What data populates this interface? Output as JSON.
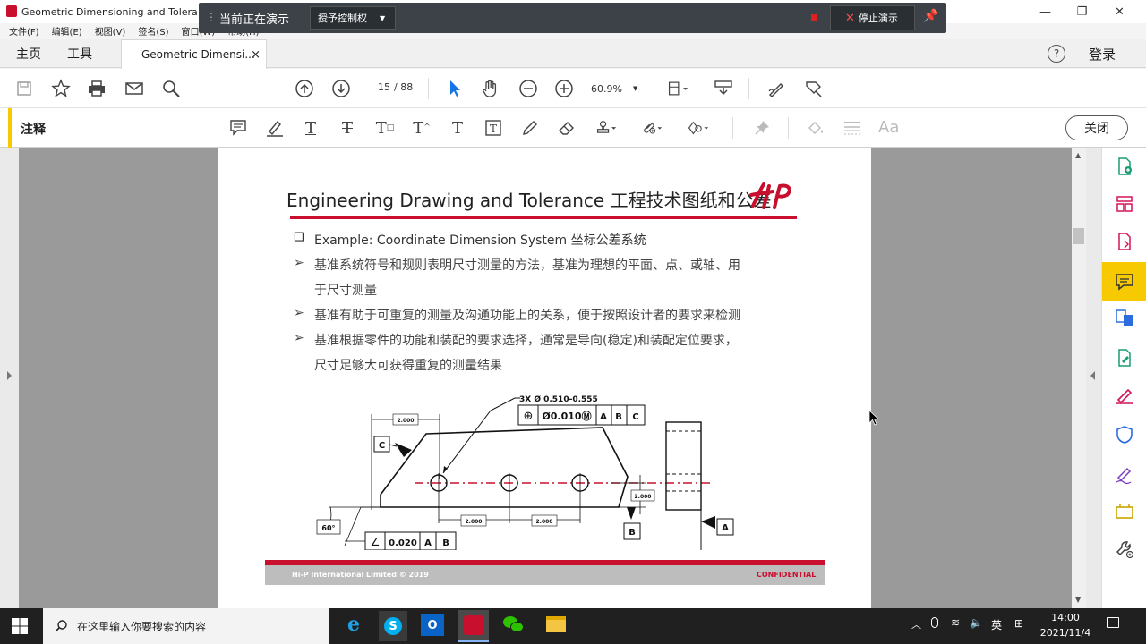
{
  "window": {
    "title": "Geometric Dimensioning and Tolera",
    "minimize": "—",
    "restore": "❐",
    "close": "✕"
  },
  "presentation": {
    "status": "当前正在演示",
    "control": "授予控制权",
    "stop": "停止演示"
  },
  "menu": [
    "文件(F)",
    "编辑(E)",
    "视图(V)",
    "签名(S)",
    "窗口(W)",
    "帮助(H)"
  ],
  "tabs": {
    "home": "主页",
    "tools": "工具",
    "doc": "Geometric Dimensi...",
    "close": "×",
    "help": "?",
    "login": "登录"
  },
  "nav": {
    "page": "15",
    "total": "/ 88",
    "zoom": "60.9%"
  },
  "annot": {
    "label": "注释",
    "close": "关闭",
    "font": "Aa"
  },
  "slide": {
    "title": "Engineering Drawing and Tolerance 工程技术图纸和公差",
    "bullets": [
      {
        "marker": "❑",
        "text": "Example: Coordinate Dimension System 坐标公差系统"
      },
      {
        "marker": "➢",
        "text": "基准系统符号和规则表明尺寸测量的方法，基准为理想的平面、点、或轴、用"
      },
      {
        "marker": "",
        "text": "于尺寸测量"
      },
      {
        "marker": "➢",
        "text": "基准有助于可重复的测量及沟通功能上的关系，便于按照设计者的要求来检测"
      },
      {
        "marker": "➢",
        "text": "基准根据零件的功能和装配的要求选择，通常是导向(稳定)和装配定位要求，"
      },
      {
        "marker": "",
        "text": "尺寸足够大可获得重复的测量结果"
      }
    ],
    "drawing": {
      "holes": "3X Ø 0.510-0.555",
      "fcf": [
        "⊕",
        "Ø0.010Ⓜ",
        "A",
        "B",
        "C"
      ],
      "angle_fcf": [
        "∠",
        "0.020",
        "A",
        "B"
      ],
      "dims": [
        "2.000",
        "2.000",
        "2.000",
        "2.000"
      ],
      "angle": "60°",
      "datums": [
        "C",
        "B",
        "A"
      ]
    },
    "footer_left": "Hi-P International Limited © 2019",
    "footer_right": "CONFIDENTIAL"
  },
  "taskbar": {
    "search": "在这里输入你要搜索的内容",
    "lang": "英",
    "time": "14:00",
    "date": "2021/11/4"
  }
}
